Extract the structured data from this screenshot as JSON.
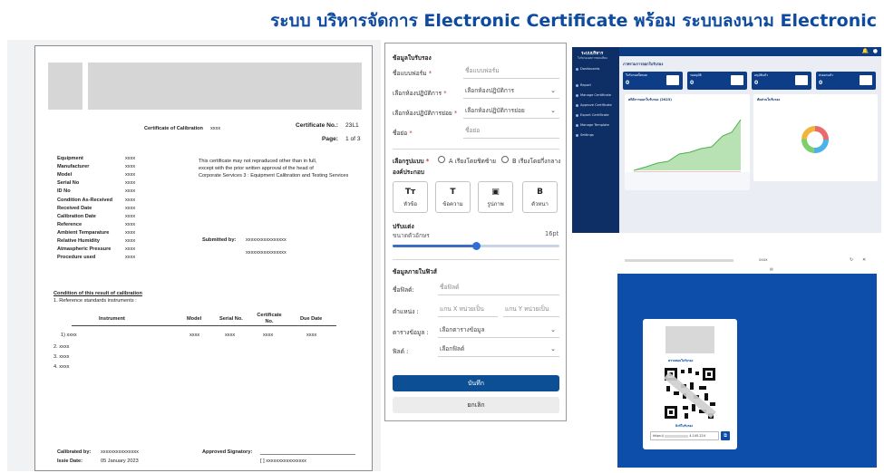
{
  "banner": {
    "title": "ระบบ บริหารจัดการ Electronic Certificate พร้อม ระบบลงนาม Electronic"
  },
  "certificate": {
    "title": "Certificate of Calibration",
    "title_value": "xxxx",
    "cert_no_label": "Certificate No.:",
    "cert_no_value": "23L1",
    "page_label": "Page:",
    "page_value": "1 of 3",
    "fields": [
      {
        "label": "Equipment",
        "value": "xxxx"
      },
      {
        "label": "Manufacturer",
        "value": "xxxx"
      },
      {
        "label": "Model",
        "value": "xxxx"
      },
      {
        "label": "Serial No",
        "value": "xxxx"
      },
      {
        "label": "ID No",
        "value": "xxxx"
      },
      {
        "label": "Condition As-Received",
        "value": "xxxx"
      },
      {
        "label": "Received Date",
        "value": "xxxx"
      },
      {
        "label": "Calibration Date",
        "value": "xxxx"
      },
      {
        "label": "Reference",
        "value": "xxxx"
      },
      {
        "label": "Ambient Temparature",
        "value": "xxxx"
      },
      {
        "label": "Relative Humidity",
        "value": "xxxx"
      },
      {
        "label": "Atmaspheric Pressure",
        "value": "xxxx"
      },
      {
        "label": "Procedure used",
        "value": "xxxx"
      }
    ],
    "notice": [
      "This certificate may not repraduced other than in full,",
      "except with the prior written approval of the head of",
      "Corporate Services 3 : Equipment Calibration and Testing Services"
    ],
    "submitted_label": "Submitted by:",
    "submitted_value_1": "xxxxxxxxxxxxxxxx",
    "submitted_value_2": "xxxxxxxxxxxxxxxx",
    "condition_heading": "Condition of this result of calibration",
    "condition_item": "1. Reference standards instruments :",
    "table_headers": [
      "Instrument",
      "Model",
      "Serial No.",
      "Certificate No.",
      "Due Date"
    ],
    "table_row": [
      "1) xxxx",
      "xxxx",
      "xxxx",
      "xxxx",
      "xxxx"
    ],
    "list_items": [
      "2. xxxx",
      "3. xxxx",
      "4. xxxx"
    ],
    "calibrated_label": "Calibrated by:",
    "calibrated_value": "xxxxxxxxxxxxxxx",
    "issue_label": "Issie Date:",
    "issue_value": "05 January 2023",
    "approved_label": "Approved Signatory:",
    "approved_value": "[ ] xxxxxxxxxxxxxxxx"
  },
  "form": {
    "section_info": "ข้อมูลใบรับรอง",
    "form_name_label": "ชื่อแบบฟอร์ม",
    "form_name_placeholder": "ชื่อแบบฟอร์ม",
    "lab_label": "เลือกห้องปฏิบัติการ",
    "lab_value": "เลือกห้องปฏิบัติการ",
    "sublab_label": "เลือกห้องปฏิบัติการย่อย",
    "sublab_value": "เลือกห้องปฏิบัติการย่อย",
    "short_label": "ชื่อย่อ",
    "short_placeholder": "ชื่อย่อ",
    "format_label": "เลือกรูปแบบ",
    "format_a": "A เรียงโดยชิดซ้าย",
    "format_b": "B เรียงโดยกึ่งกลาง",
    "components_label": "องค์ประกอบ",
    "tools": [
      {
        "glyph": "Tт",
        "label": "หัวข้อ"
      },
      {
        "glyph": "T",
        "label": "ข้อความ"
      },
      {
        "glyph": "▣",
        "label": "รูปภาพ"
      },
      {
        "glyph": "B",
        "label": "ตัวหนา"
      }
    ],
    "adjust_label": "ปรับแต่ง",
    "font_size_label": "ขนาดตัวอักษร",
    "font_size_value": "16pt",
    "font_size_fraction": 0.5,
    "section_fields": "ข้อมูลภายในฟิวส์",
    "field_name_label": "ชื่อฟิลด์:",
    "field_name_placeholder": "ชื่อฟิลด์",
    "position_label": "ตำแหน่ง :",
    "position_x_placeholder": "แกน X หน่วยเป็น",
    "position_y_placeholder": "แกน Y หน่วยเป็น",
    "table_label": "ตารางข้อมูล :",
    "table_value": "เลือกตารางข้อมูล",
    "field_label": "ฟิลด์ :",
    "field_value": "เลือกฟิลด์",
    "save_label": "บันทึก",
    "cancel_label": "ยกเลิก",
    "required_mark": "*"
  },
  "dashboard": {
    "brand": "ระบบบริหาร",
    "brand_sub": "ใบรับรองผลการสอบเทียบ",
    "menu": [
      "Dashboards",
      "Report",
      "Manage Certificate",
      "Approve Certificate",
      "Export Certificate",
      "Manage Template",
      "Settings"
    ],
    "header": "ภาพรวมการออกใบรับรอง",
    "cards": [
      {
        "label": "ใบรับรองทั้งหมด",
        "value": "0"
      },
      {
        "label": "รออนุมัติ",
        "value": "0"
      },
      {
        "label": "อนุมัติแล้ว",
        "value": "0"
      },
      {
        "label": "ส่งออกแล้ว",
        "value": "0"
      }
    ],
    "chart_title": "สถิติการออกใบรับรอง (2023)",
    "donut_title": "สัดส่วนใบรับรอง",
    "accent": "#0d3d86"
  },
  "verify": {
    "url_text": "xxxx",
    "card_title": "ตรวจสอบใบรับรอง",
    "card_label": "ลิงก์ใบรับรอง",
    "link_prefix": "https://",
    "link_suffix": "4-145-224"
  }
}
